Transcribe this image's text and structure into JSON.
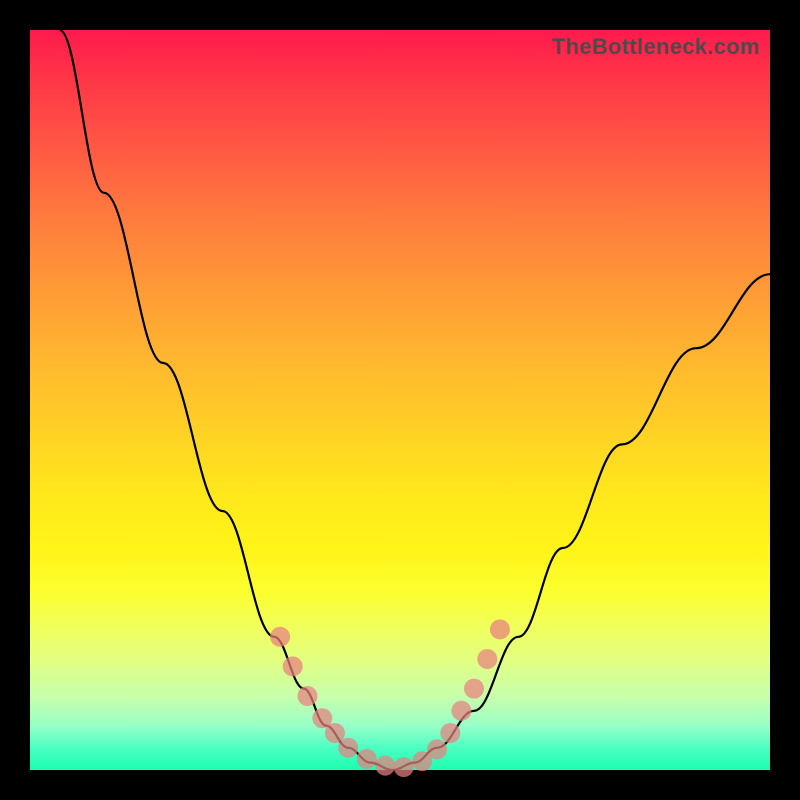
{
  "watermark": "TheBottleneck.com",
  "chart_data": {
    "type": "line",
    "title": "",
    "xlabel": "",
    "ylabel": "",
    "xlim": [
      0,
      100
    ],
    "ylim": [
      0,
      100
    ],
    "series": [
      {
        "name": "bottleneck-curve",
        "x": [
          4,
          10,
          18,
          26,
          33,
          37,
          40,
          43,
          46,
          49,
          52,
          55,
          60,
          66,
          72,
          80,
          90,
          100
        ],
        "y": [
          100,
          78,
          55,
          35,
          18,
          11,
          6,
          3,
          1,
          0,
          1,
          3,
          8,
          18,
          30,
          44,
          57,
          67
        ]
      }
    ],
    "markers": {
      "name": "highlighted-points",
      "x": [
        33.8,
        35.5,
        37.5,
        39.5,
        41.2,
        43.0,
        45.5,
        48.0,
        50.5,
        53.0,
        55.0,
        56.8,
        58.3,
        60.0,
        61.8,
        63.5
      ],
      "y": [
        18,
        14,
        10,
        7,
        5,
        3,
        1.5,
        0.6,
        0.4,
        1.2,
        2.8,
        5,
        8,
        11,
        15,
        19
      ]
    }
  }
}
